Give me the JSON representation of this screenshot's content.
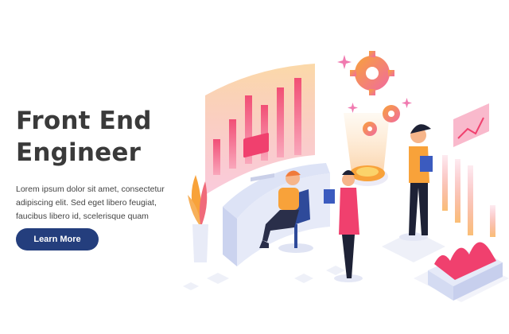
{
  "hero": {
    "title_line1": "Front End",
    "title_line2": "Engineer",
    "description": "Lorem ipsum dolor sit amet, consectetur adipiscing elit. Sed eget libero feugiat, faucibus libero id, scelerisque quam",
    "cta_label": "Learn More"
  },
  "colors": {
    "title": "#3a3a3a",
    "cta_bg": "#243e7d",
    "accent_pink": "#f0406e",
    "accent_orange": "#f8a23a"
  },
  "illustration": {
    "subject": "isometric-front-end-engineer-workspace",
    "icons": [
      "gear-icon",
      "bar-chart-icon",
      "line-chart-icon",
      "sparkle-icon",
      "plant-icon"
    ]
  }
}
